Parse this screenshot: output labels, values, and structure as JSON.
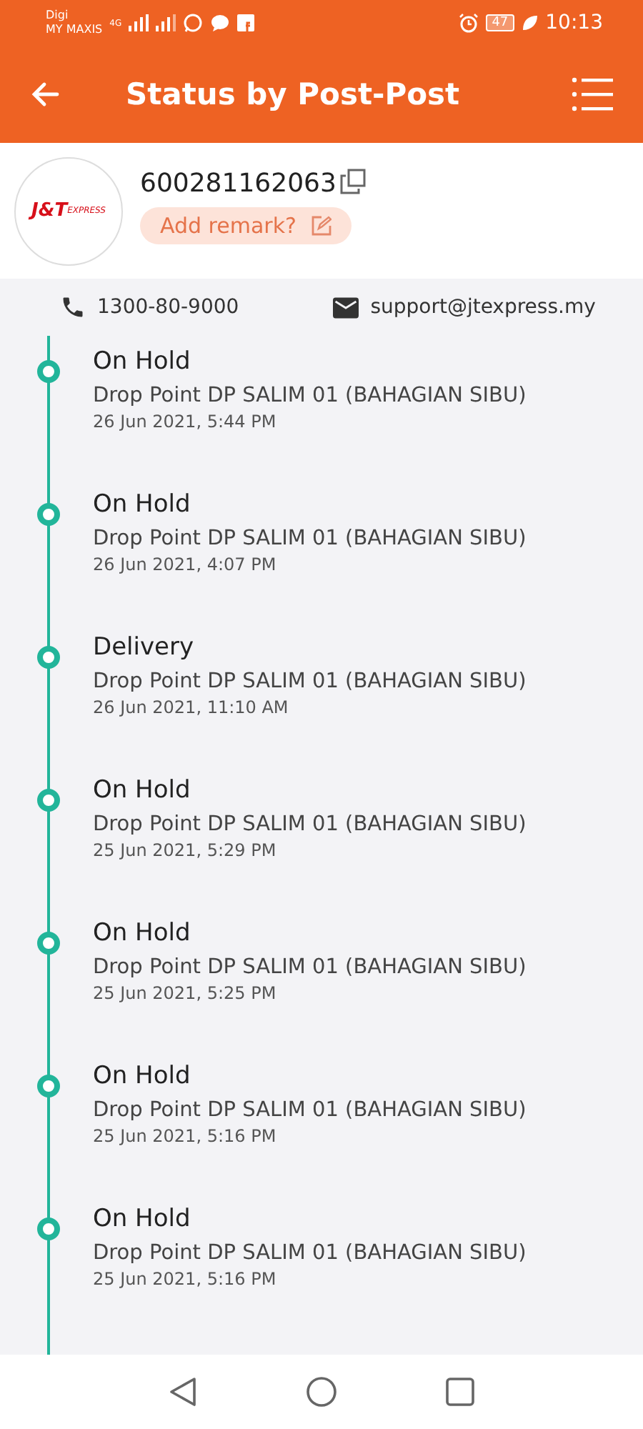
{
  "status_bar": {
    "carrier_1": "Digi",
    "carrier_2": "MY MAXIS",
    "network": "4G",
    "battery": "47",
    "time": "10:13"
  },
  "header": {
    "title": "Status by Post-Post"
  },
  "parcel": {
    "logo": "J&T",
    "logo_sub": "EXPRESS",
    "tracking_number": "600281162063",
    "remark_button": "Add remark?"
  },
  "contact": {
    "phone": "1300-80-9000",
    "email": "support@jtexpress.my"
  },
  "events": [
    {
      "status": "On Hold",
      "location": "Drop Point DP SALIM 01 (BAHAGIAN SIBU)",
      "time": "26 Jun 2021, 5:44 PM"
    },
    {
      "status": "On Hold",
      "location": "Drop Point DP SALIM 01 (BAHAGIAN SIBU)",
      "time": "26 Jun 2021, 4:07 PM"
    },
    {
      "status": "Delivery",
      "location": "Drop Point DP SALIM 01 (BAHAGIAN SIBU)",
      "time": "26 Jun 2021, 11:10 AM"
    },
    {
      "status": "On Hold",
      "location": "Drop Point DP SALIM 01 (BAHAGIAN SIBU)",
      "time": "25 Jun 2021, 5:29 PM"
    },
    {
      "status": "On Hold",
      "location": "Drop Point DP SALIM 01 (BAHAGIAN SIBU)",
      "time": "25 Jun 2021, 5:25 PM"
    },
    {
      "status": "On Hold",
      "location": "Drop Point DP SALIM 01 (BAHAGIAN SIBU)",
      "time": "25 Jun 2021, 5:16 PM"
    },
    {
      "status": "On Hold",
      "location": "Drop Point DP SALIM 01 (BAHAGIAN SIBU)",
      "time": "25 Jun 2021, 5:16 PM"
    }
  ]
}
